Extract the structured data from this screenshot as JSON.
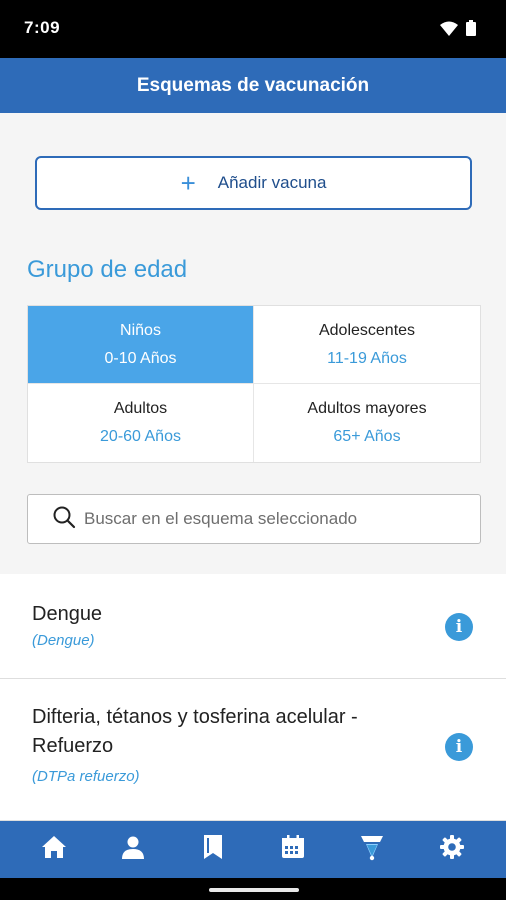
{
  "status": {
    "time": "7:09"
  },
  "app_bar": {
    "title": "Esquemas de vacunación"
  },
  "add_button": {
    "label": "Añadir vacuna"
  },
  "age_group": {
    "title": "Grupo de edad",
    "groups": [
      {
        "label": "Niños",
        "range": "0-10 Años",
        "selected": true
      },
      {
        "label": "Adolescentes",
        "range": "11-19 Años",
        "selected": false
      },
      {
        "label": "Adultos",
        "range": "20-60 Años",
        "selected": false
      },
      {
        "label": "Adultos mayores",
        "range": "65+ Años",
        "selected": false
      }
    ]
  },
  "search": {
    "placeholder": "Buscar en el esquema seleccionado"
  },
  "vaccines": [
    {
      "name": "Dengue",
      "abbr": "(Dengue)"
    },
    {
      "name": "Difteria, tétanos y tosferina acelular - Refuerzo",
      "abbr": "(DTPa refuerzo)"
    }
  ],
  "bottom_nav": {
    "items": [
      "home-icon",
      "profile-icon",
      "bookmark-icon",
      "calendar-icon",
      "vaccine-icon",
      "gear-icon"
    ],
    "active": "vaccine-icon"
  },
  "colors": {
    "primary": "#2e6bb8",
    "accent": "#3a9ad9",
    "selected_cell": "#4aa5e8"
  }
}
